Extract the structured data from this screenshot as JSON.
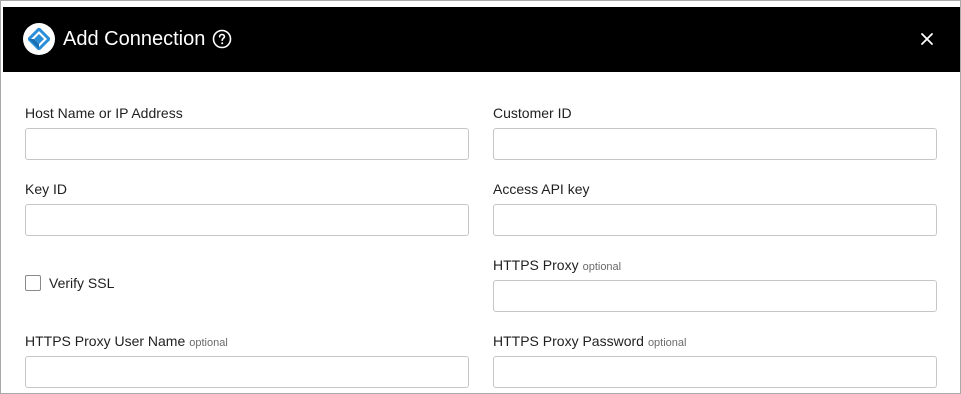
{
  "dialog": {
    "title": "Add Connection",
    "close_icon": "close-icon",
    "help_icon": "help-circle-icon",
    "logo_icon": "connector-logo-icon"
  },
  "colors": {
    "header_bg": "#000000",
    "header_text": "#ffffff",
    "logo_blue": "#2a8fd8"
  },
  "fields": {
    "host": {
      "label": "Host Name or IP Address",
      "value": ""
    },
    "customer_id": {
      "label": "Customer ID",
      "value": ""
    },
    "key_id": {
      "label": "Key ID",
      "value": ""
    },
    "access_api_key": {
      "label": "Access API key",
      "value": ""
    },
    "verify_ssl": {
      "label": "Verify SSL",
      "checked": false
    },
    "https_proxy": {
      "label": "HTTPS Proxy",
      "optional": "optional",
      "value": ""
    },
    "proxy_user": {
      "label": "HTTPS Proxy User Name",
      "optional": "optional",
      "value": ""
    },
    "proxy_password": {
      "label": "HTTPS Proxy Password",
      "optional": "optional",
      "value": ""
    }
  }
}
